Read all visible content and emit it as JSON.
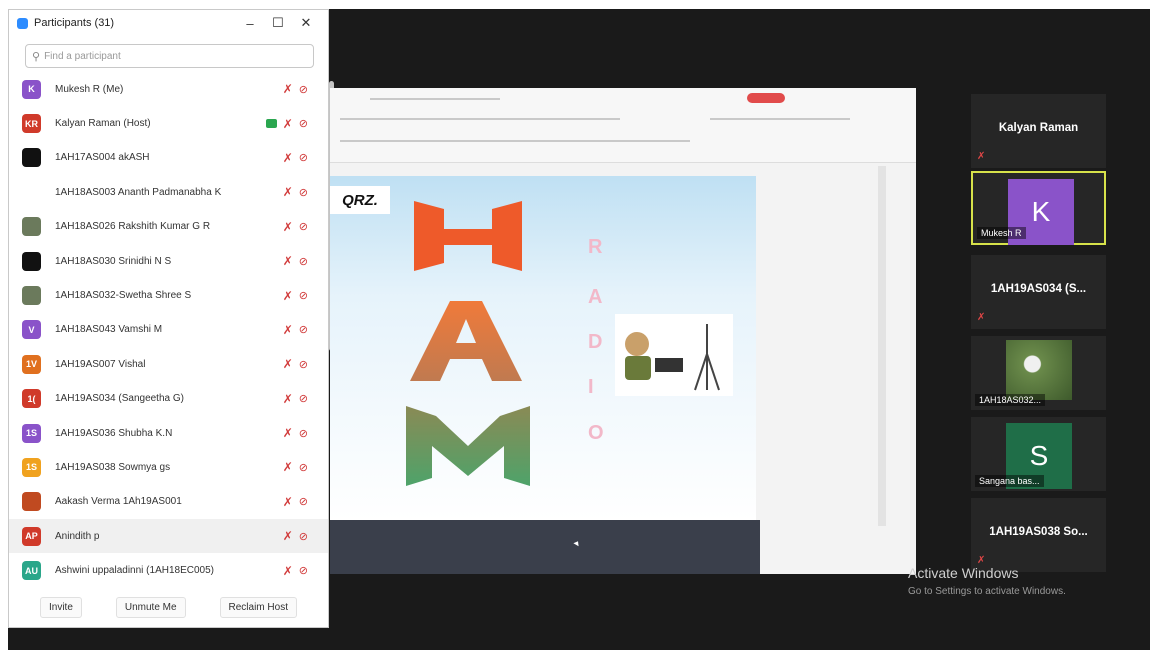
{
  "panel": {
    "title": "Participants (31)",
    "search_placeholder": "Find a participant",
    "participants": [
      {
        "initials": "K",
        "color": "#8a53c9",
        "name": "Mukesh R (Me)"
      },
      {
        "initials": "KR",
        "color": "#d03a2a",
        "name": "Kalyan Raman (Host)"
      },
      {
        "initials": "",
        "color": "#111111",
        "name": "1AH17AS004 akASH"
      },
      {
        "initials": "",
        "color": "#ffffff",
        "name": "1AH18AS003 Ananth Padmanabha K"
      },
      {
        "initials": "",
        "color": "#6b7a5c",
        "name": "1AH18AS026 Rakshith Kumar G R"
      },
      {
        "initials": "",
        "color": "#111111",
        "name": "1AH18AS030 Srinidhi N S"
      },
      {
        "initials": "",
        "color": "#6b7a5c",
        "name": "1AH18AS032-Swetha Shree S"
      },
      {
        "initials": "V",
        "color": "#8a53c9",
        "name": "1AH18AS043 Vamshi M"
      },
      {
        "initials": "1V",
        "color": "#e0701f",
        "name": "1AH19AS007 Vishal"
      },
      {
        "initials": "1(",
        "color": "#d03a2a",
        "name": "1AH19AS034 (Sangeetha G)"
      },
      {
        "initials": "1S",
        "color": "#8a53c9",
        "name": "1AH19AS036 Shubha K.N"
      },
      {
        "initials": "1S",
        "color": "#f0a21f",
        "name": "1AH19AS038 Sowmya gs"
      },
      {
        "initials": "",
        "color": "#c04a20",
        "name": "Aakash Verma 1Ah19AS001"
      },
      {
        "initials": "AP",
        "color": "#d03a2a",
        "name": "Anindith p"
      },
      {
        "initials": "AU",
        "color": "#2aa68a",
        "name": "Ashwini uppaladinni (1AH18EC005)"
      }
    ],
    "buttons": {
      "invite": "Invite",
      "unmute": "Unmute Me",
      "reclaim": "Reclaim Host"
    }
  },
  "slide": {
    "logo": "QRZ.",
    "radio_letters": [
      "R",
      "A",
      "D",
      "I",
      "O"
    ]
  },
  "gallery": [
    {
      "name": "Kalyan Raman",
      "type": "name"
    },
    {
      "name": "Mukesh R",
      "type": "avatar",
      "initial": "K",
      "color": "#8a53c9",
      "active": true
    },
    {
      "name": "1AH19AS034 (S...",
      "type": "name"
    },
    {
      "name": "1AH18AS032...",
      "type": "photo"
    },
    {
      "name": "Sangana bas...",
      "type": "avatar",
      "initial": "S",
      "color": "#1f6e48"
    },
    {
      "name": "1AH19AS038 So...",
      "type": "name"
    }
  ],
  "watermark": {
    "line1": "Activate Windows",
    "line2": "Go to Settings to activate Windows."
  }
}
